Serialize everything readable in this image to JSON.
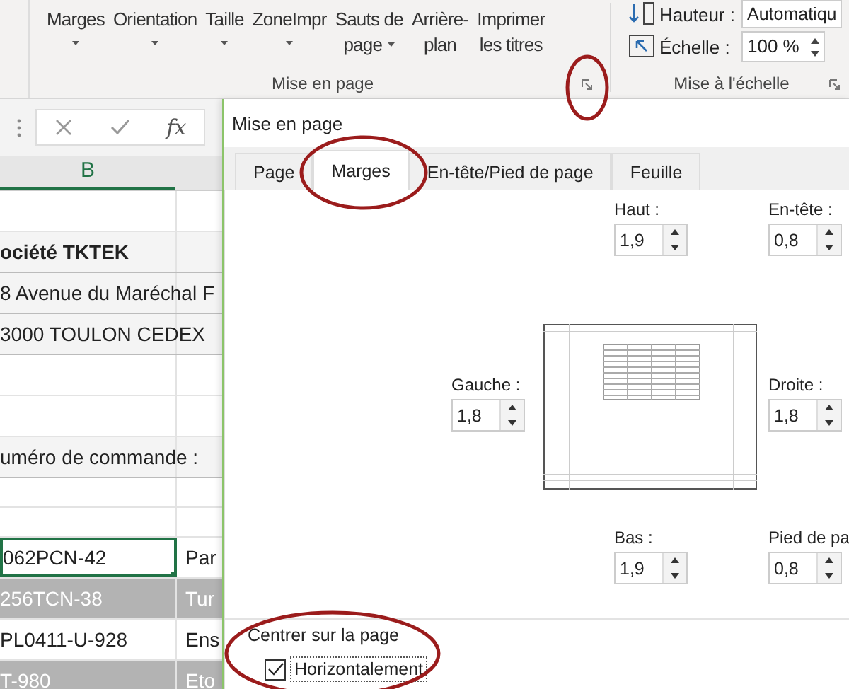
{
  "ribbon": {
    "page_setup_group": {
      "label": "Mise en page",
      "buttons": [
        {
          "lines": [
            "Marges"
          ],
          "dropdown": true
        },
        {
          "lines": [
            "Orientation"
          ],
          "dropdown": true
        },
        {
          "lines": [
            "Taille"
          ],
          "dropdown": true
        },
        {
          "lines": [
            "ZoneImpr"
          ],
          "dropdown": true
        },
        {
          "lines": [
            "Sauts de",
            "page"
          ],
          "dropdown": true
        },
        {
          "lines": [
            "Arrière-",
            "plan"
          ],
          "dropdown": false
        },
        {
          "lines": [
            "Imprimer",
            "les titres"
          ],
          "dropdown": false
        }
      ]
    },
    "scale_group": {
      "label": "Mise à l'échelle",
      "fields": [
        {
          "kind": "dropdown",
          "label": "Hauteur :",
          "value": "Automatiqu"
        },
        {
          "kind": "spin",
          "label": "Échelle :",
          "value": "100 %"
        }
      ]
    }
  },
  "formula_bar": {
    "function_label": "fx"
  },
  "sheet": {
    "column_header": "B",
    "rows": [
      {
        "kind": "blank",
        "shaded": false,
        "selected": false
      },
      {
        "kind": "boxed",
        "col_b": "ociété TKTEK",
        "shaded": false,
        "bold": true,
        "selected": false
      },
      {
        "kind": "boxed",
        "col_b": "8 Avenue du Maréchal F",
        "shaded": false,
        "bold": false,
        "selected": false
      },
      {
        "kind": "boxed",
        "col_b": "3000 TOULON CEDEX",
        "shaded": false,
        "bold": false,
        "selected": false
      },
      {
        "kind": "blank",
        "shaded": false,
        "selected": false
      },
      {
        "kind": "blank",
        "shaded": false,
        "selected": false
      },
      {
        "kind": "boxed",
        "col_b": "uméro de commande :",
        "shaded": false,
        "bold": false,
        "selected": false
      },
      {
        "kind": "small",
        "shaded": false,
        "selected": false
      },
      {
        "kind": "small",
        "shaded": false,
        "selected": false
      },
      {
        "kind": "data",
        "col_b": "062PCN-42",
        "col_c": "Par",
        "shaded": false,
        "bold": false,
        "selected": true
      },
      {
        "kind": "data",
        "col_b": "256TCN-38",
        "col_c": "Tur",
        "shaded": true,
        "bold": false,
        "selected": false
      },
      {
        "kind": "data",
        "col_b": "PL0411-U-928",
        "col_c": "Ens",
        "shaded": false,
        "bold": false,
        "selected": false
      },
      {
        "kind": "data",
        "col_b": "T-980",
        "col_c": "Eto",
        "shaded": true,
        "bold": false,
        "selected": false
      }
    ]
  },
  "dialog": {
    "title": "Mise en page",
    "tabs": [
      {
        "label": "Page",
        "selected": false
      },
      {
        "label": "Marges",
        "selected": true
      },
      {
        "label": "En-tête/Pied de page",
        "selected": false
      },
      {
        "label": "Feuille",
        "selected": false
      }
    ],
    "margins": {
      "top": {
        "label": "Haut :",
        "value": "1,9"
      },
      "header": {
        "label": "En-tête :",
        "value": "0,8"
      },
      "left": {
        "label": "Gauche :",
        "value": "1,8"
      },
      "right": {
        "label": "Droite :",
        "value": "1,8"
      },
      "bottom": {
        "label": "Bas :",
        "value": "1,9"
      },
      "footer": {
        "label": "Pied de pa",
        "value": "0,8"
      }
    },
    "center_section": {
      "title": "Centrer sur la page",
      "options": [
        {
          "label": "Horizontalement",
          "checked": true
        }
      ]
    }
  }
}
